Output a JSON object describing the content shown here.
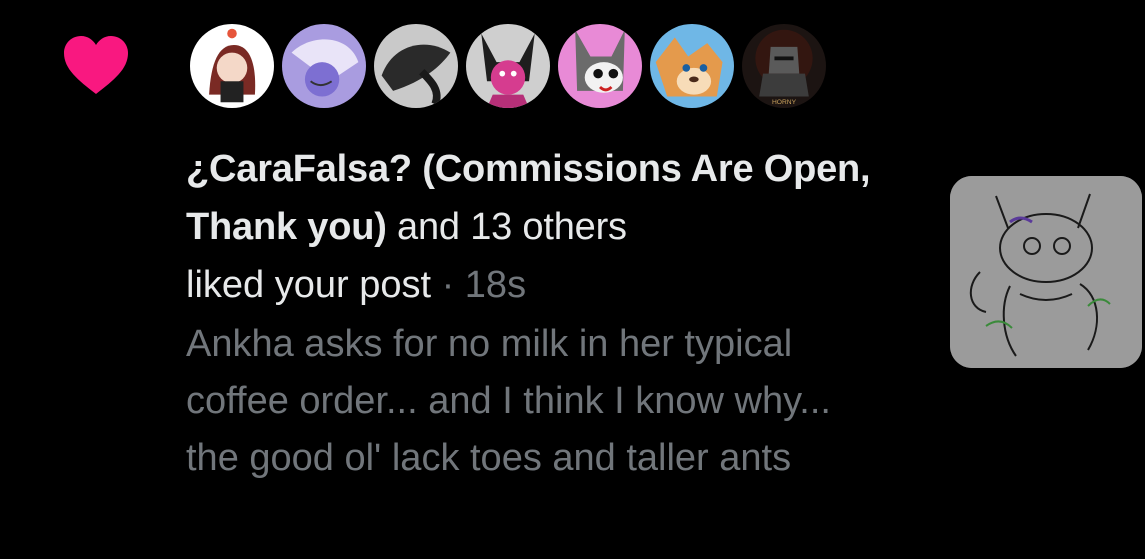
{
  "notification": {
    "type_icon": "heart-icon",
    "accent_color": "#f91880",
    "avatars": [
      {
        "name": "avatar-1"
      },
      {
        "name": "avatar-2"
      },
      {
        "name": "avatar-3"
      },
      {
        "name": "avatar-4"
      },
      {
        "name": "avatar-5"
      },
      {
        "name": "avatar-6"
      },
      {
        "name": "avatar-7",
        "badge_text": "HORNY"
      }
    ],
    "actor_name": "¿CaraFalsa? (Commissions Are Open, Thank you)",
    "others_text": " and 13 others",
    "action_text": "liked your post",
    "separator": " · ",
    "timestamp": "18s",
    "post_text": "Ankha asks for no milk in her typical coffee order... and I think I know why... the good ol' lack toes and taller ants"
  }
}
